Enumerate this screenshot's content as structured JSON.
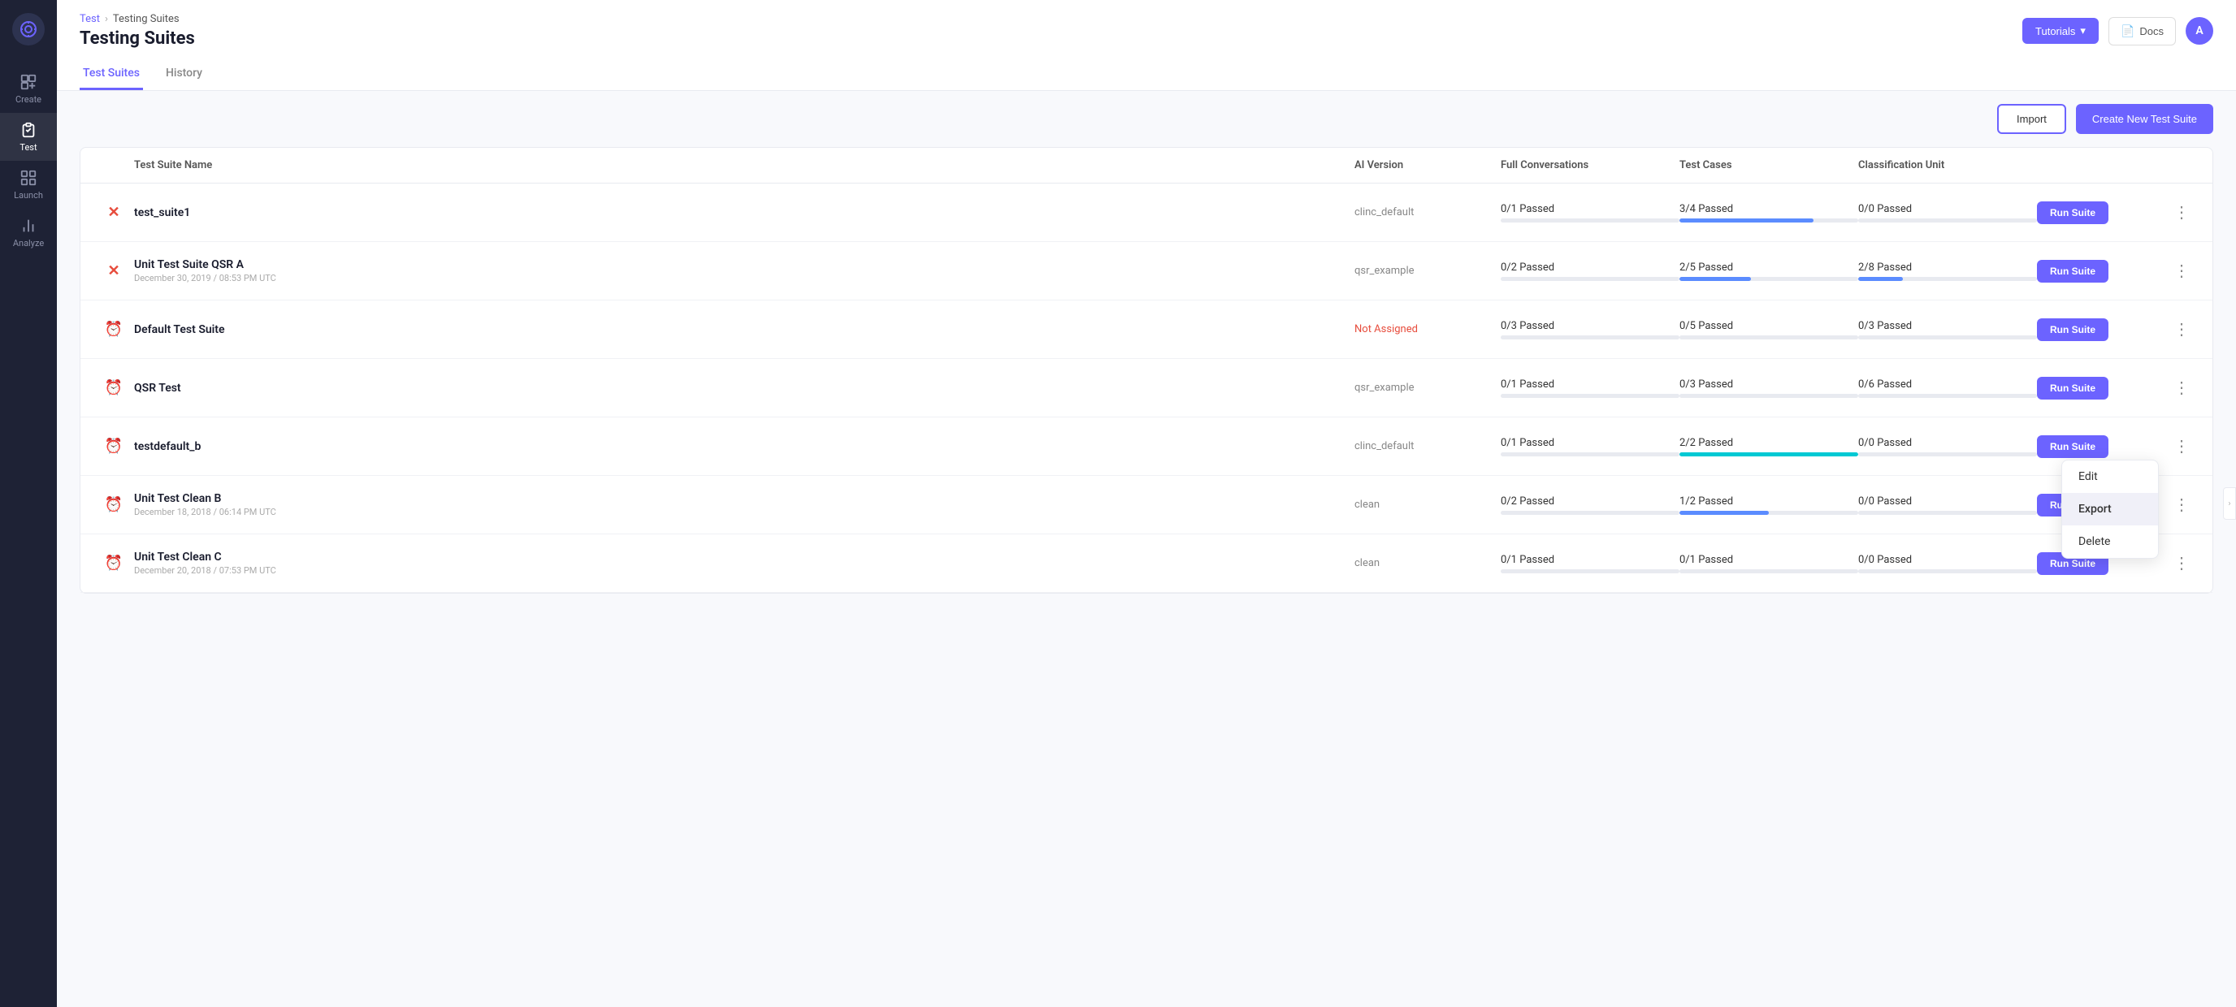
{
  "sidebar": {
    "logo_icon": "target-icon",
    "items": [
      {
        "label": "Create",
        "icon": "create-icon",
        "active": false
      },
      {
        "label": "Test",
        "icon": "test-icon",
        "active": true
      },
      {
        "label": "Launch",
        "icon": "launch-icon",
        "active": false
      },
      {
        "label": "Analyze",
        "icon": "analyze-icon",
        "active": false
      }
    ]
  },
  "header": {
    "breadcrumb_root": "Test",
    "breadcrumb_current": "Testing Suites",
    "title": "Testing Suites",
    "tutorials_label": "Tutorials",
    "docs_label": "Docs",
    "avatar_label": "A"
  },
  "tabs": [
    {
      "label": "Test Suites",
      "active": true
    },
    {
      "label": "History",
      "active": false
    }
  ],
  "toolbar": {
    "import_label": "Import",
    "create_label": "Create New Test Suite"
  },
  "table": {
    "columns": [
      "",
      "Test Suite Name",
      "AI Version",
      "Full Conversations",
      "Test Cases",
      "Classification Unit",
      "",
      ""
    ],
    "rows": [
      {
        "icon": "x",
        "name": "test_suite1",
        "date": "",
        "ai_version": "clinc_default",
        "ai_version_type": "normal",
        "full_conv_label": "0/1 Passed",
        "full_conv_pct": 0,
        "test_cases_label": "3/4 Passed",
        "test_cases_pct": 75,
        "test_cases_color": "blue",
        "class_unit_label": "0/0 Passed",
        "class_unit_pct": 0,
        "show_dropdown": false
      },
      {
        "icon": "x",
        "name": "Unit Test Suite QSR A",
        "date": "December 30, 2019 / 08:53 PM UTC",
        "ai_version": "qsr_example",
        "ai_version_type": "normal",
        "full_conv_label": "0/2 Passed",
        "full_conv_pct": 0,
        "test_cases_label": "2/5 Passed",
        "test_cases_pct": 40,
        "test_cases_color": "blue",
        "class_unit_label": "2/8 Passed",
        "class_unit_pct": 25,
        "class_unit_color": "blue",
        "show_dropdown": false
      },
      {
        "icon": "clock",
        "name": "Default Test Suite",
        "date": "",
        "ai_version": "Not Assigned",
        "ai_version_type": "not-assigned",
        "full_conv_label": "0/3 Passed",
        "full_conv_pct": 0,
        "test_cases_label": "0/5 Passed",
        "test_cases_pct": 0,
        "test_cases_color": "zero",
        "class_unit_label": "0/3 Passed",
        "class_unit_pct": 0,
        "show_dropdown": false
      },
      {
        "icon": "clock",
        "name": "QSR Test",
        "date": "",
        "ai_version": "qsr_example",
        "ai_version_type": "normal",
        "full_conv_label": "0/1 Passed",
        "full_conv_pct": 0,
        "test_cases_label": "0/3 Passed",
        "test_cases_pct": 0,
        "test_cases_color": "zero",
        "class_unit_label": "0/6 Passed",
        "class_unit_pct": 0,
        "show_dropdown": false
      },
      {
        "icon": "clock",
        "name": "testdefault_b",
        "date": "",
        "ai_version": "clinc_default",
        "ai_version_type": "normal",
        "full_conv_label": "0/1 Passed",
        "full_conv_pct": 0,
        "test_cases_label": "2/2 Passed",
        "test_cases_pct": 100,
        "test_cases_color": "cyan",
        "class_unit_label": "0/0 Passed",
        "class_unit_pct": 0,
        "show_dropdown": true
      },
      {
        "icon": "clock",
        "name": "Unit Test Clean B",
        "date": "December 18, 2018 / 06:14 PM UTC",
        "ai_version": "clean",
        "ai_version_type": "normal",
        "full_conv_label": "0/2 Passed",
        "full_conv_pct": 0,
        "test_cases_label": "1/2 Passed",
        "test_cases_pct": 50,
        "test_cases_color": "blue",
        "class_unit_label": "0/0 Passed",
        "class_unit_pct": 0,
        "show_dropdown": false
      },
      {
        "icon": "clock",
        "name": "Unit Test Clean C",
        "date": "December 20, 2018 / 07:53 PM UTC",
        "ai_version": "clean",
        "ai_version_type": "normal",
        "full_conv_label": "0/1 Passed",
        "full_conv_pct": 0,
        "test_cases_label": "0/1 Passed",
        "test_cases_pct": 0,
        "test_cases_color": "zero",
        "class_unit_label": "0/0 Passed",
        "class_unit_pct": 0,
        "show_dropdown": false
      }
    ],
    "dropdown_items": [
      "Edit",
      "Export",
      "Delete"
    ],
    "run_label": "Run Suite"
  }
}
